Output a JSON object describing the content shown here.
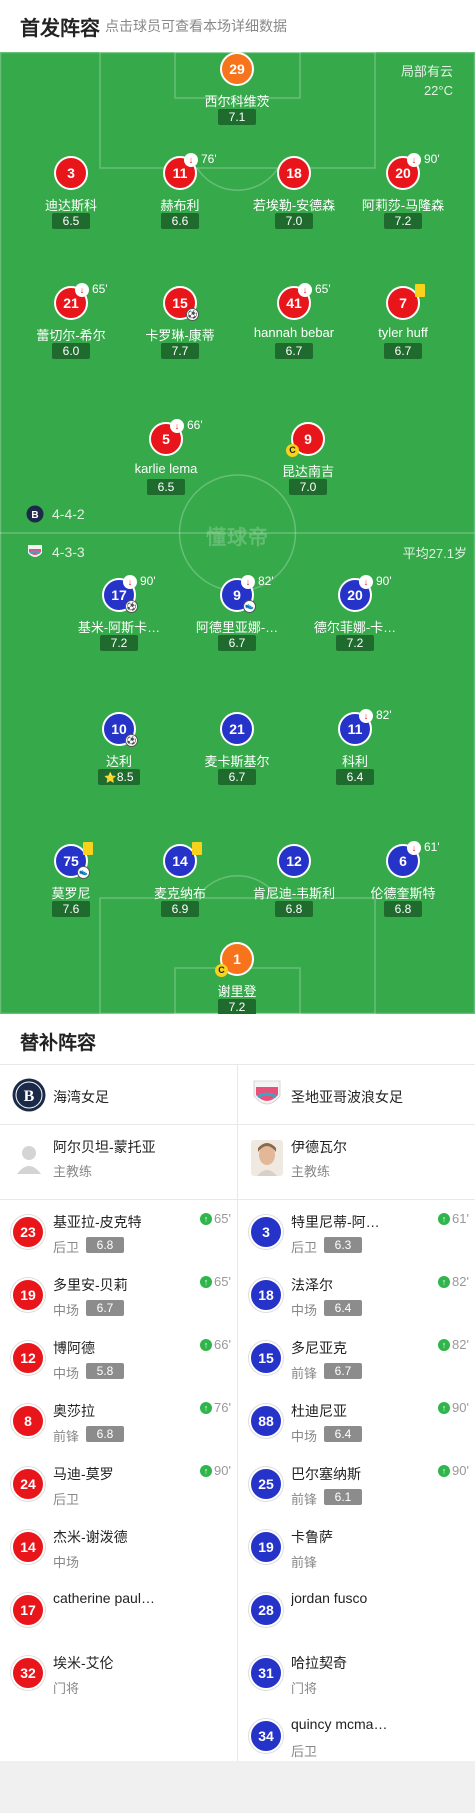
{
  "header": {
    "title": "首发阵容",
    "hint": "点击球员可查看本场详细数据"
  },
  "pitch": {
    "weather": "局部有云",
    "temperature": "22°C",
    "watermark": "懂球帝",
    "home_formation": "4-4-2",
    "away_formation": "4-3-3",
    "away_avg_age": "平均27.1岁"
  },
  "colors": {
    "pitch": "#36a94a",
    "home": "#e8151b",
    "away": "#2533c9",
    "keeper": "#f7731c",
    "yellow_card": "#f8d21b",
    "sub_in": "#2fb54a"
  },
  "home_players": [
    {
      "number": "29",
      "name": "西尔科维茨",
      "rating": "7.1",
      "kit": "orange"
    },
    {
      "number": "3",
      "name": "迪达斯科",
      "rating": "6.5",
      "kit": "red"
    },
    {
      "number": "11",
      "name": "赫布利",
      "rating": "6.6",
      "kit": "red",
      "sub_off": "76'"
    },
    {
      "number": "18",
      "name": "若埃勒-安德森",
      "rating": "7.0",
      "kit": "red"
    },
    {
      "number": "20",
      "name": "阿莉莎-马隆森",
      "rating": "7.2",
      "kit": "red",
      "sub_off": "90'"
    },
    {
      "number": "21",
      "name": "蕾切尔-希尔",
      "rating": "6.0",
      "kit": "red",
      "sub_off": "65'"
    },
    {
      "number": "15",
      "name": "卡罗琳-康蒂",
      "rating": "7.7",
      "kit": "red",
      "goal": true
    },
    {
      "number": "41",
      "name": "hannah bebar",
      "rating": "6.7",
      "kit": "red",
      "sub_off": "65'"
    },
    {
      "number": "7",
      "name": "tyler huff",
      "rating": "6.7",
      "kit": "red",
      "yellow": true
    },
    {
      "number": "5",
      "name": "karlie lema",
      "rating": "6.5",
      "kit": "red",
      "sub_off": "66'"
    },
    {
      "number": "9",
      "name": "昆达南吉",
      "rating": "7.0",
      "kit": "red",
      "captain": "C"
    }
  ],
  "away_players": [
    {
      "number": "17",
      "name": "基米-阿斯卡…",
      "rating": "7.2",
      "kit": "blue",
      "sub_off": "90'",
      "goal": true
    },
    {
      "number": "9",
      "name": "阿德里亚娜-…",
      "rating": "6.7",
      "kit": "blue",
      "sub_off": "82'",
      "assist": true
    },
    {
      "number": "20",
      "name": "德尔菲娜-卡…",
      "rating": "7.2",
      "kit": "blue",
      "sub_off": "90'"
    },
    {
      "number": "10",
      "name": "达利",
      "rating": "8.5",
      "kit": "blue",
      "goal": true,
      "star": "⭐"
    },
    {
      "number": "21",
      "name": "麦卡斯基尔",
      "rating": "6.7",
      "kit": "blue"
    },
    {
      "number": "11",
      "name": "科利",
      "rating": "6.4",
      "kit": "blue",
      "sub_off": "82'"
    },
    {
      "number": "75",
      "name": "莫罗尼",
      "rating": "7.6",
      "kit": "blue",
      "yellow": true,
      "assist": true
    },
    {
      "number": "14",
      "name": "麦克纳布",
      "rating": "6.9",
      "kit": "blue",
      "yellow": true
    },
    {
      "number": "12",
      "name": "肯尼迪-韦斯利",
      "rating": "6.8",
      "kit": "blue"
    },
    {
      "number": "6",
      "name": "伦德奎斯特",
      "rating": "6.8",
      "kit": "blue",
      "sub_off": "61'"
    },
    {
      "number": "1",
      "name": "谢里登",
      "rating": "7.2",
      "kit": "orange",
      "captain": "C"
    }
  ],
  "subs": {
    "title": "替补阵容",
    "home": {
      "team": "海湾女足",
      "coach": "阿尔贝坦-蒙托亚",
      "coach_role": "主教练",
      "players": [
        {
          "number": "23",
          "name": "基亚拉-皮克特",
          "position": "后卫",
          "rating": "6.8",
          "in": "65'"
        },
        {
          "number": "19",
          "name": "多里安-贝莉",
          "position": "中场",
          "rating": "6.7",
          "in": "65'"
        },
        {
          "number": "12",
          "name": "博阿德",
          "position": "中场",
          "rating": "5.8",
          "in": "66'"
        },
        {
          "number": "8",
          "name": "奥莎拉",
          "position": "前锋",
          "rating": "6.8",
          "in": "76'"
        },
        {
          "number": "24",
          "name": "马迪-莫罗",
          "position": "后卫",
          "rating": "",
          "in": "90'"
        },
        {
          "number": "14",
          "name": "杰米-谢泼德",
          "position": "中场",
          "rating": "",
          "in": ""
        },
        {
          "number": "17",
          "name": "catherine paul…",
          "position": "",
          "rating": "",
          "in": ""
        },
        {
          "number": "32",
          "name": "埃米-艾伦",
          "position": "门将",
          "rating": "",
          "in": ""
        }
      ]
    },
    "away": {
      "team": "圣地亚哥波浪女足",
      "coach": "伊德瓦尔",
      "coach_role": "主教练",
      "players": [
        {
          "number": "3",
          "name": "特里尼蒂-阿…",
          "position": "后卫",
          "rating": "6.3",
          "in": "61'"
        },
        {
          "number": "18",
          "name": "法泽尔",
          "position": "中场",
          "rating": "6.4",
          "in": "82'"
        },
        {
          "number": "15",
          "name": "多尼亚克",
          "position": "前锋",
          "rating": "6.7",
          "in": "82'"
        },
        {
          "number": "88",
          "name": "杜迪尼亚",
          "position": "中场",
          "rating": "6.4",
          "in": "90'"
        },
        {
          "number": "25",
          "name": "巴尔塞纳斯",
          "position": "前锋",
          "rating": "6.1",
          "in": "90'"
        },
        {
          "number": "19",
          "name": "卡鲁萨",
          "position": "前锋",
          "rating": "",
          "in": ""
        },
        {
          "number": "28",
          "name": "jordan fusco",
          "position": "",
          "rating": "",
          "in": ""
        },
        {
          "number": "31",
          "name": "哈拉契奇",
          "position": "门将",
          "rating": "",
          "in": ""
        },
        {
          "number": "34",
          "name": "quincy mcma…",
          "position": "后卫",
          "rating": "",
          "in": ""
        }
      ]
    }
  }
}
